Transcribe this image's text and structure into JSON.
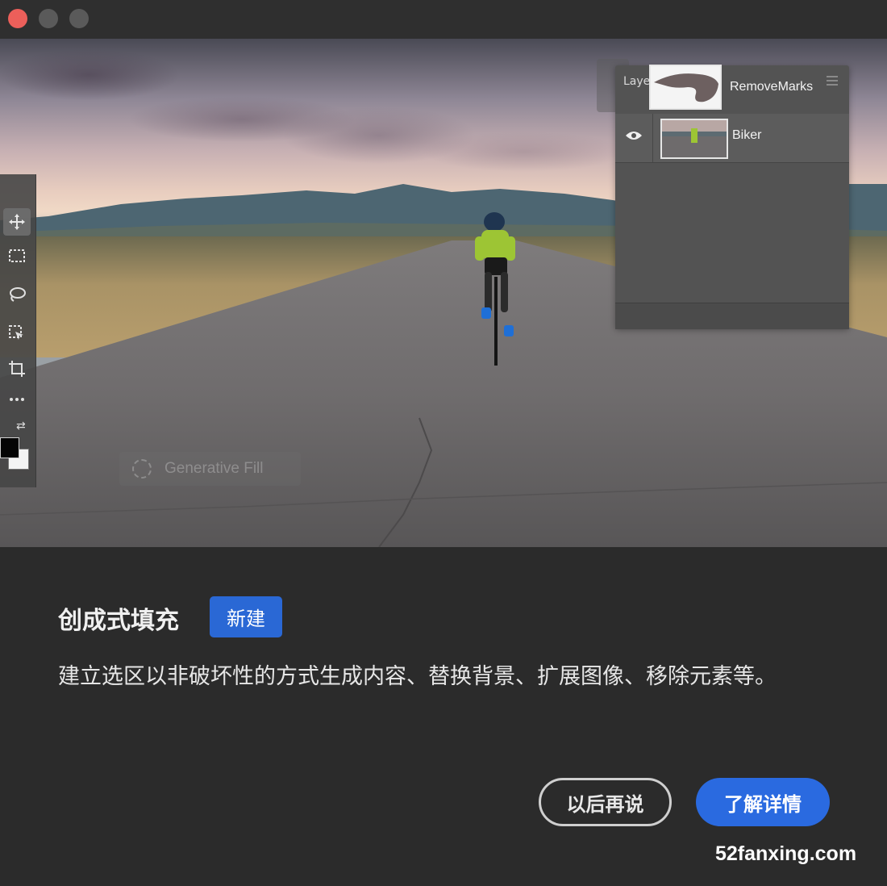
{
  "window": {
    "traffic_lights": {
      "close_color": "#ec5f5a",
      "inactive_color": "#5a5a5a"
    }
  },
  "hero": {
    "layers_panel": {
      "title": "Laye",
      "layers": [
        {
          "name": "RemoveMarks",
          "thumbnail": "mask-thumbnail"
        },
        {
          "name": "Biker",
          "thumbnail": "photo-thumbnail",
          "visible": true
        }
      ]
    },
    "toolbar": {
      "tools": [
        "move-icon",
        "marquee-icon",
        "lasso-icon",
        "object-select-icon",
        "crop-icon",
        "more-tools-icon"
      ],
      "foreground_color": "#050505",
      "background_color": "#f4f4f4"
    },
    "generative_fill_ghost": "Generative Fill"
  },
  "dialog": {
    "title": "创成式填充",
    "badge": "新建",
    "badge_color": "#2a68d5",
    "description": "建立选区以非破坏性的方式生成内容、替换背景、扩展图像、移除元素等。",
    "buttons": {
      "later": "以后再说",
      "learn_more": "了解详情"
    },
    "accent_color": "#2a6ae0"
  },
  "watermark": "52fanxing.com"
}
